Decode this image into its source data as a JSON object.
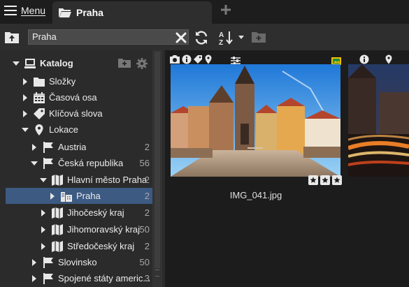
{
  "topbar": {
    "menu_label": "Menu",
    "tab_label": "Praha",
    "new_tab_icon": "plus-icon"
  },
  "toolbar": {
    "search_value": "Praha",
    "sort_label": "A→Z"
  },
  "sidebar": {
    "catalog_label": "Katalog",
    "items": [
      {
        "label": "Složky",
        "count": ""
      },
      {
        "label": "Časová osa",
        "count": ""
      },
      {
        "label": "Klíčová slova",
        "count": ""
      },
      {
        "label": "Lokace",
        "count": ""
      },
      {
        "label": "Austria",
        "count": "2"
      },
      {
        "label": "Česká republika",
        "count": "56"
      },
      {
        "label": "Hlavní město Praha",
        "count": "2"
      },
      {
        "label": "Praha",
        "count": "2"
      },
      {
        "label": "Jihočeský kraj",
        "count": "2"
      },
      {
        "label": "Jihomoravský kraj",
        "count": "50"
      },
      {
        "label": "Středočeský kraj",
        "count": "2"
      },
      {
        "label": "Slovinsko",
        "count": "50"
      },
      {
        "label": "Spojené státy americ...",
        "count": "3"
      }
    ]
  },
  "main": {
    "thumbnails": [
      {
        "filename": "IMG_041.jpg",
        "rating": 3
      },
      {
        "filename": "",
        "rating": 0
      }
    ]
  },
  "colors": {
    "selection": "#3c5a82",
    "panel": "#2b2b2b",
    "toolbar": "#2e2e2e",
    "background": "#1c1c1c"
  }
}
